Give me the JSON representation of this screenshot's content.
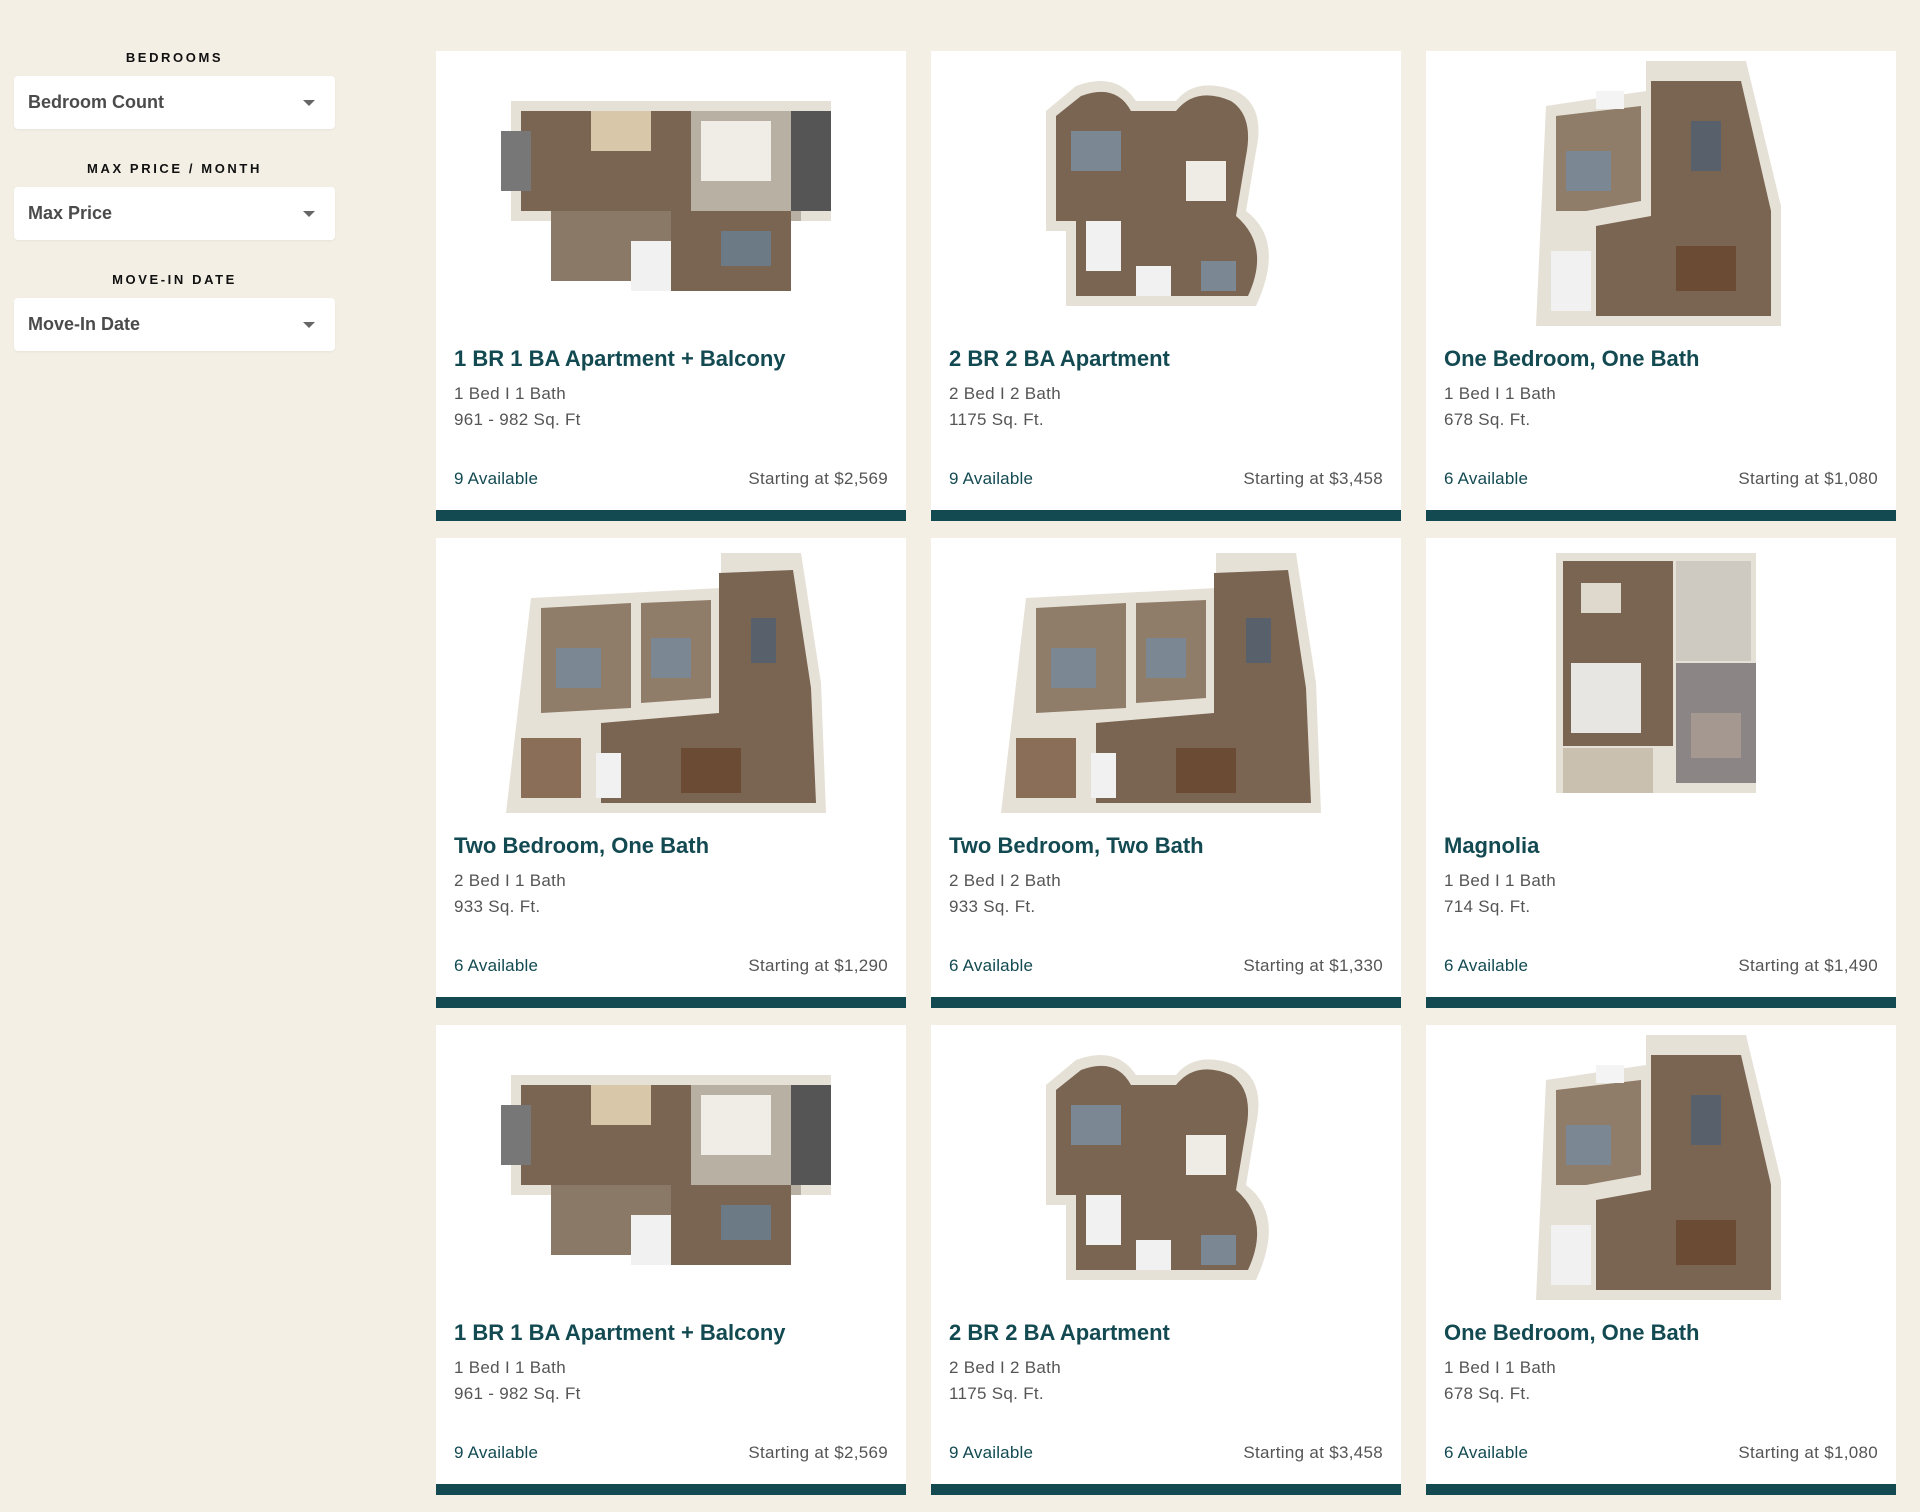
{
  "filters": [
    {
      "label": "BEDROOMS",
      "value": "Bedroom Count"
    },
    {
      "label": "MAX PRICE / MONTH",
      "value": "Max Price"
    },
    {
      "label": "MOVE-IN DATE",
      "value": "Move-In Date"
    }
  ],
  "colors": {
    "background": "#f3efe5",
    "accent": "#134a52",
    "floor_wood": "#7a6452",
    "wall": "#e6e1d6"
  },
  "cards": [
    {
      "title": "1 BR 1 BA Apartment + Balcony",
      "beds": "1 Bed I 1 Bath",
      "sqft": "961 - 982 Sq. Ft",
      "available": "9 Available",
      "price": "Starting at $2,569",
      "plan": "wide"
    },
    {
      "title": "2 BR 2 BA Apartment",
      "beds": "2 Bed I 2 Bath",
      "sqft": "1175 Sq. Ft.",
      "available": "9 Available",
      "price": "Starting at $3,458",
      "plan": "curved"
    },
    {
      "title": "One Bedroom, One Bath",
      "beds": "1 Bed I 1 Bath",
      "sqft": "678 Sq. Ft.",
      "available": "6 Available",
      "price": "Starting at $1,080",
      "plan": "iso-one"
    },
    {
      "title": "Two Bedroom, One Bath",
      "beds": "2 Bed I 1 Bath",
      "sqft": "933 Sq. Ft.",
      "available": "6 Available",
      "price": "Starting at $1,290",
      "plan": "iso-two"
    },
    {
      "title": "Two Bedroom, Two Bath",
      "beds": "2 Bed I 2 Bath",
      "sqft": "933 Sq. Ft.",
      "available": "6 Available",
      "price": "Starting at $1,330",
      "plan": "iso-two"
    },
    {
      "title": "Magnolia",
      "beds": "1 Bed I 1 Bath",
      "sqft": "714 Sq. Ft.",
      "available": "6 Available",
      "price": "Starting at $1,490",
      "plan": "magnolia"
    },
    {
      "title": "1 BR 1 BA Apartment + Balcony",
      "beds": "1 Bed I 1 Bath",
      "sqft": "961 - 982 Sq. Ft",
      "available": "9 Available",
      "price": "Starting at $2,569",
      "plan": "wide"
    },
    {
      "title": "2 BR 2 BA Apartment",
      "beds": "2 Bed I 2 Bath",
      "sqft": "1175 Sq. Ft.",
      "available": "9 Available",
      "price": "Starting at $3,458",
      "plan": "curved"
    },
    {
      "title": "One Bedroom, One Bath",
      "beds": "1 Bed I 1 Bath",
      "sqft": "678 Sq. Ft.",
      "available": "6 Available",
      "price": "Starting at $1,080",
      "plan": "iso-one"
    }
  ]
}
